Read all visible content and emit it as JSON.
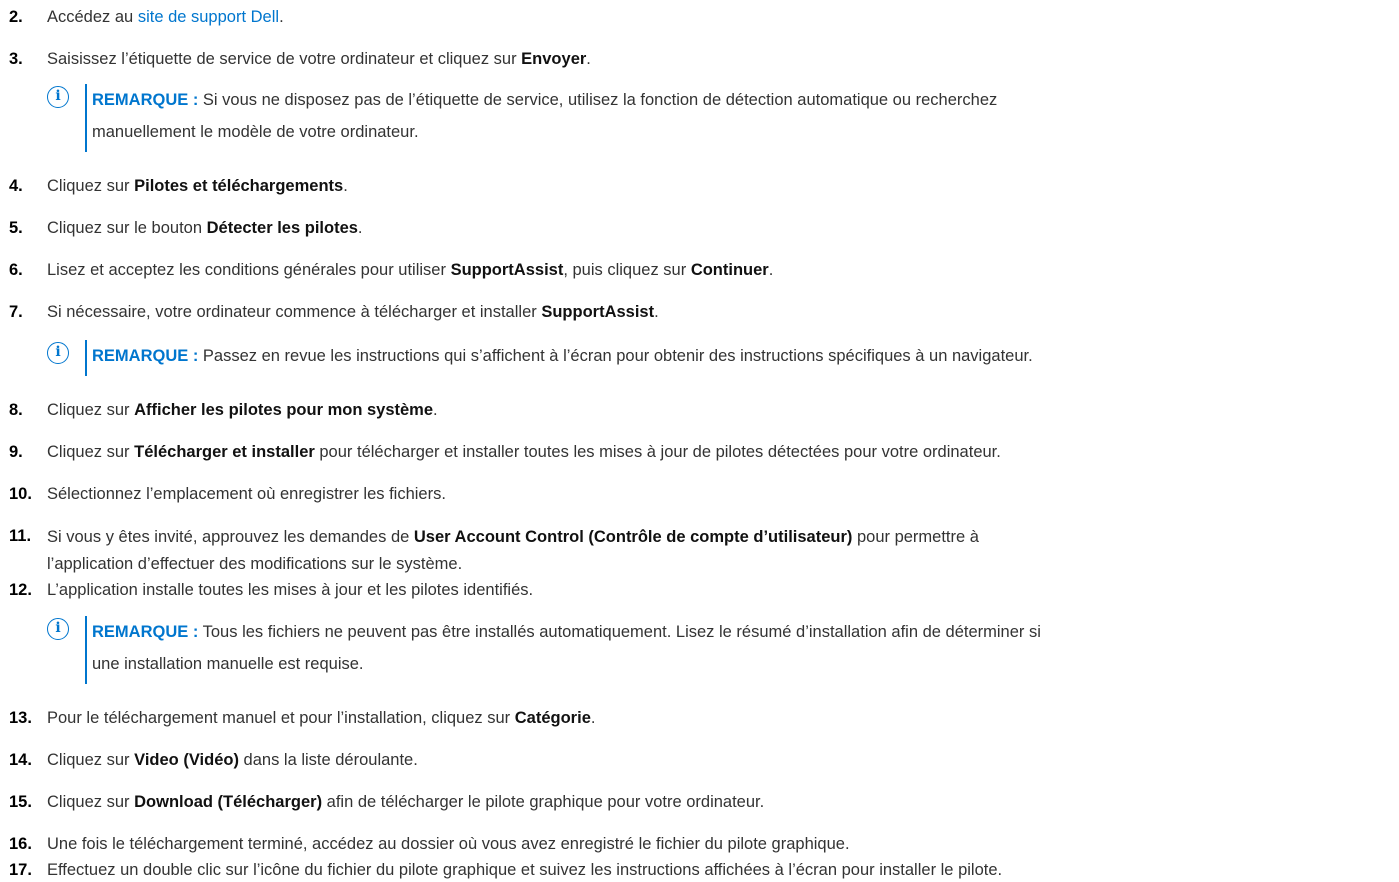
{
  "steps": {
    "s2": {
      "num": "2.",
      "pre": "Accédez au ",
      "link": "site de support Dell",
      "post": "."
    },
    "s3": {
      "num": "3.",
      "pre": "Saisissez l’étiquette de service de votre ordinateur et cliquez sur ",
      "bold": "Envoyer",
      "post": "."
    },
    "s4": {
      "num": "4.",
      "pre": "Cliquez sur ",
      "bold": "Pilotes et téléchargements",
      "post": "."
    },
    "s5": {
      "num": "5.",
      "pre": "Cliquez sur le bouton ",
      "bold": "Détecter les pilotes",
      "post": "."
    },
    "s6": {
      "num": "6.",
      "pre": "Lisez et acceptez les conditions générales pour utiliser ",
      "bold": "SupportAssist",
      "mid": ", puis cliquez sur ",
      "bold2": "Continuer",
      "post": "."
    },
    "s7": {
      "num": "7.",
      "pre": "Si nécessaire, votre ordinateur commence à télécharger et installer ",
      "bold": "SupportAssist",
      "post": "."
    },
    "s8": {
      "num": "8.",
      "pre": "Cliquez sur ",
      "bold": "Afficher les pilotes pour mon système",
      "post": "."
    },
    "s9": {
      "num": "9.",
      "pre": "Cliquez sur ",
      "bold": "Télécharger et installer",
      "post": " pour télécharger et installer toutes les mises à jour de pilotes détectées pour votre ordinateur."
    },
    "s10": {
      "num": "10.",
      "pre": "Sélectionnez l’emplacement où enregistrer les fichiers."
    },
    "s11": {
      "num": "11.",
      "pre": "Si vous y êtes invité, approuvez les demandes de ",
      "bold": "User Account Control (Contrôle de compte d’utilisateur)",
      "post": " pour permettre à",
      "line2": "l’application d’effectuer des modifications sur le système."
    },
    "s12": {
      "num": "12.",
      "pre": "L’application installe toutes les mises à jour et les pilotes identifiés."
    },
    "s13": {
      "num": "13.",
      "pre": "Pour le téléchargement manuel et pour l’installation, cliquez sur ",
      "bold": "Catégorie",
      "post": "."
    },
    "s14": {
      "num": "14.",
      "pre": "Cliquez sur ",
      "bold": "Video (Vidéo)",
      "post": " dans la liste déroulante."
    },
    "s15": {
      "num": "15.",
      "pre": "Cliquez sur ",
      "bold": "Download (Télécharger)",
      "post": " afin de télécharger le pilote graphique pour votre ordinateur."
    },
    "s16": {
      "num": "16.",
      "pre": "Une fois le téléchargement terminé, accédez au dossier où vous avez enregistré le fichier du pilote graphique."
    },
    "s17": {
      "num": "17.",
      "pre": "Effectuez un double clic sur l’icône du fichier du pilote graphique et suivez les instructions affichées à l’écran pour installer le pilote."
    }
  },
  "notes": {
    "n1": {
      "label": "REMARQUE :",
      "line1": " Si vous ne disposez pas de l’étiquette de service, utilisez la fonction de détection automatique ou recherchez",
      "line2": "manuellement le modèle de votre ordinateur."
    },
    "n2": {
      "label": "REMARQUE :",
      "line1": " Passez en revue les instructions qui s’affichent à l’écran pour obtenir des instructions spécifiques à un navigateur."
    },
    "n3": {
      "label": "REMARQUE :",
      "line1": " Tous les fichiers ne peuvent pas être installés automatiquement. Lisez le résumé d’installation afin de déterminer si",
      "line2": "une installation manuelle est requise."
    }
  },
  "icons": {
    "note": "info-icon",
    "note_glyph": "i"
  },
  "colors": {
    "accent": "#0076ce",
    "text": "#333333"
  }
}
